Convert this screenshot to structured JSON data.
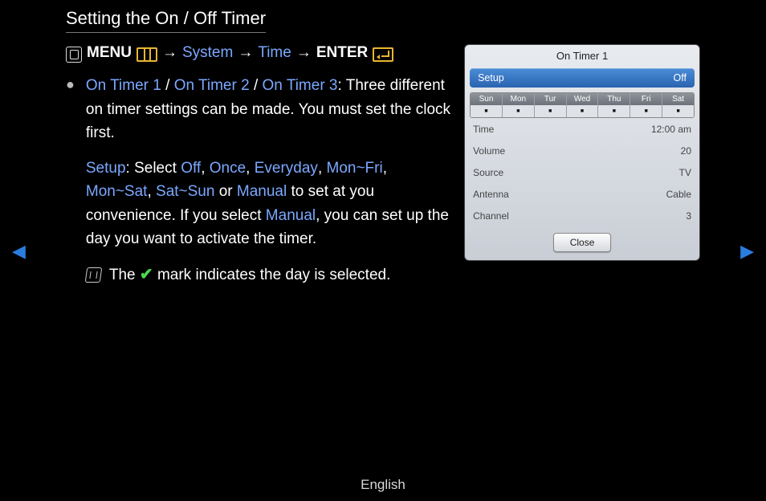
{
  "title": "Setting the On / Off Timer",
  "nav": {
    "menu": "MENU",
    "system": "System",
    "time": "Time",
    "enter": "ENTER",
    "arrow": "→"
  },
  "p1": {
    "t1": "On Timer 1",
    "t2": "On Timer 2",
    "t3": "On Timer 3",
    "slash": " / ",
    "rest": ": Three different on timer settings can be made. You must set the clock first."
  },
  "p2": {
    "setup": "Setup",
    "colon_select": ": Select ",
    "off": "Off",
    "comma": ", ",
    "once": "Once",
    "everyday": "Everyday",
    "monfri": "Mon~Fri",
    "monsat": "Mon~Sat",
    "satsun": "Sat~Sun",
    "or": " or ",
    "manual": "Manual",
    "tail": " to set at you convenience. If you select ",
    "manual2": "Manual",
    "tail2": ", you can set up the day you want to activate the timer."
  },
  "note": {
    "pre": "The ",
    "post": " mark indicates the day is selected."
  },
  "panel": {
    "title": "On Timer 1",
    "setup_label": "Setup",
    "setup_value": "Off",
    "days": [
      "Sun",
      "Mon",
      "Tur",
      "Wed",
      "Thu",
      "Fri",
      "Sat"
    ],
    "rows": [
      {
        "k": "Time",
        "v": "12:00 am"
      },
      {
        "k": "Volume",
        "v": "20"
      },
      {
        "k": "Source",
        "v": "TV"
      },
      {
        "k": "Antenna",
        "v": "Cable"
      },
      {
        "k": "Channel",
        "v": "3"
      }
    ],
    "close": "Close"
  },
  "footer": "English"
}
